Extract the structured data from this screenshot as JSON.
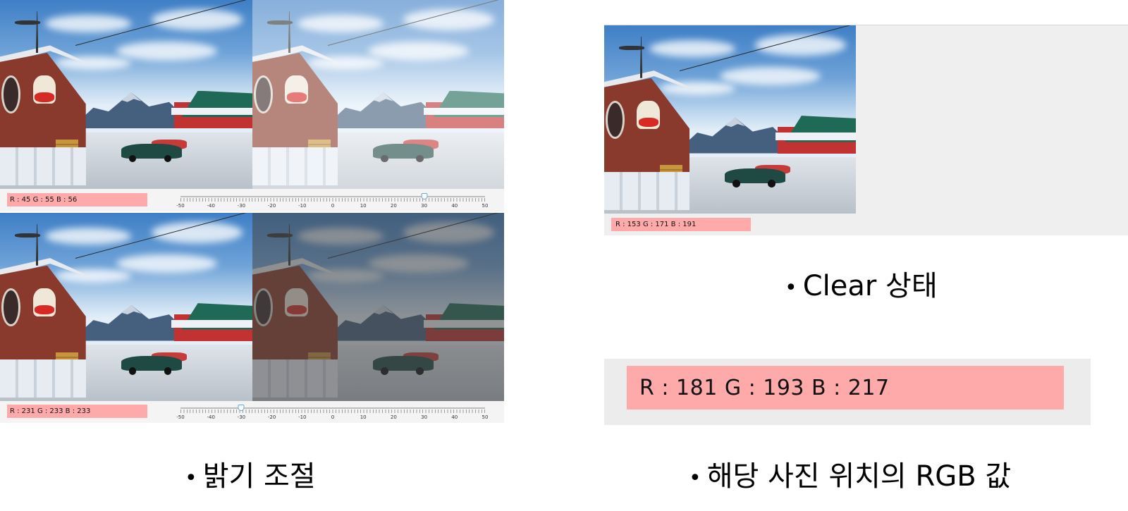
{
  "brightness_panel": {
    "top": {
      "rgb_label": "R : 45 G : 55 B : 56",
      "slider_value": 30
    },
    "bottom": {
      "rgb_label": "R : 231 G : 233 B : 233",
      "slider_value": -30
    },
    "slider_ticks": [
      "-50",
      "-40",
      "-30",
      "-20",
      "-10",
      "0",
      "10",
      "20",
      "30",
      "40",
      "50"
    ],
    "slider_range": [
      -50,
      50
    ]
  },
  "clear_panel": {
    "rgb_label": "R : 153 G : 171 B : 191"
  },
  "rgb_zoom": {
    "rgb_label": "R : 181 G : 193 B : 217"
  },
  "captions": {
    "brightness": "밝기 조절",
    "clear": "Clear 상태",
    "rgb": "해당 사진 위치의 RGB 값",
    "bullet": "•"
  },
  "colors": {
    "rgb_box": "#feaaab",
    "panel_bg": "#f0f0f0",
    "slider_thumb_border": "#6aa6d8"
  }
}
